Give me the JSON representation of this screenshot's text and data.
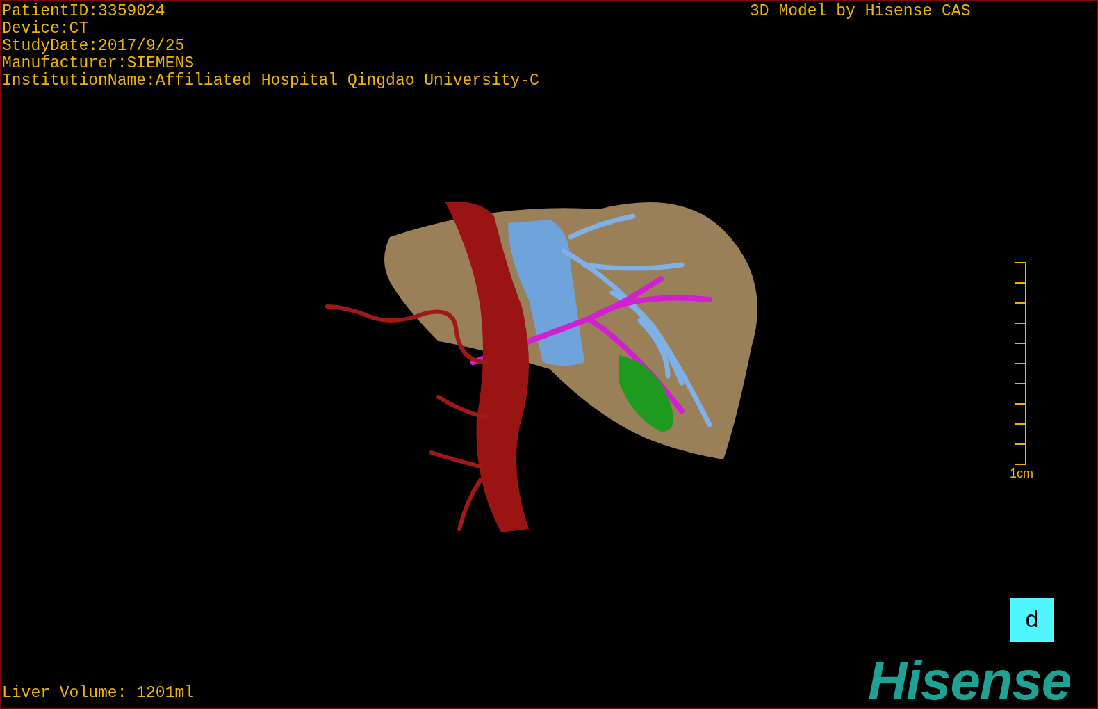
{
  "viewer": {
    "info_lines": [
      "PatientID:3359024",
      "Device:CT",
      "StudyDate:2017/9/25",
      "Manufacturer:SIEMENS",
      "InstitutionName:Affiliated Hospital Qingdao University-C"
    ],
    "title": "3D Model by Hisense CAS",
    "scale_label": "1cm",
    "view_button": "d",
    "volume": "Liver Volume: 1201ml",
    "logo": "Hisense"
  }
}
